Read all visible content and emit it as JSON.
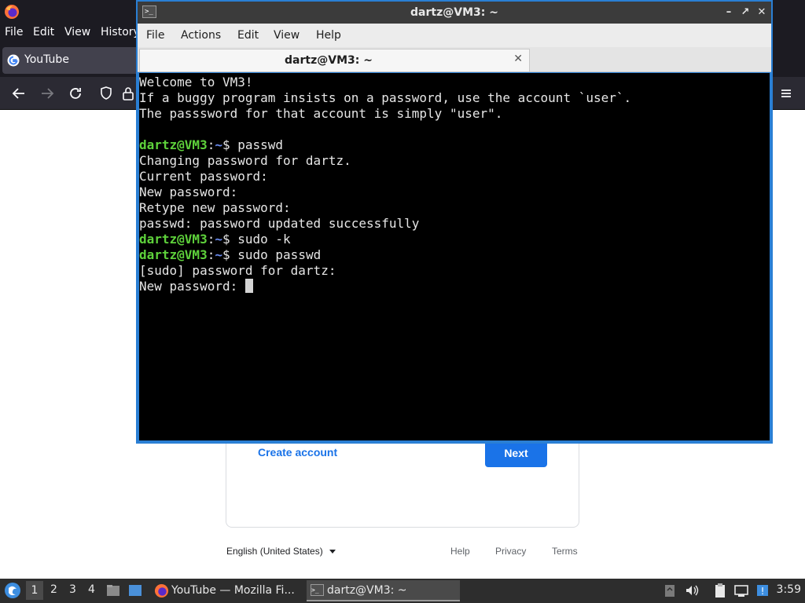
{
  "firefox": {
    "menu": [
      "File",
      "Edit",
      "View",
      "History"
    ],
    "tab_title": "YouTube"
  },
  "google_signin": {
    "create_account": "Create account",
    "next": "Next",
    "language": "English (United States)",
    "footer_links": [
      "Help",
      "Privacy",
      "Terms"
    ]
  },
  "terminal": {
    "window_title": "dartz@VM3: ~",
    "menu": [
      "File",
      "Actions",
      "Edit",
      "View",
      "Help"
    ],
    "tab_title": "dartz@VM3: ~",
    "prompt_user": "dartz@VM3",
    "prompt_path": "~",
    "lines": [
      {
        "type": "text",
        "text": "Welcome to VM3!"
      },
      {
        "type": "text",
        "text": "If a buggy program insists on a password, use the account `user`."
      },
      {
        "type": "text",
        "text": "The passsword for that account is simply \"user\"."
      },
      {
        "type": "text",
        "text": ""
      },
      {
        "type": "prompt",
        "text": "passwd"
      },
      {
        "type": "text",
        "text": "Changing password for dartz."
      },
      {
        "type": "text",
        "text": "Current password:"
      },
      {
        "type": "text",
        "text": "New password:"
      },
      {
        "type": "text",
        "text": "Retype new password:"
      },
      {
        "type": "text",
        "text": "passwd: password updated successfully"
      },
      {
        "type": "prompt",
        "text": "sudo -k"
      },
      {
        "type": "prompt",
        "text": "sudo passwd"
      },
      {
        "type": "text",
        "text": "[sudo] password for dartz:"
      },
      {
        "type": "cursor",
        "text": "New password: "
      }
    ]
  },
  "taskbar": {
    "workspaces": [
      "1",
      "2",
      "3",
      "4"
    ],
    "tasks": [
      "YouTube — Mozilla Fi...",
      "dartz@VM3: ~"
    ],
    "clock": "3:59"
  },
  "colors": {
    "terminal_bg": "#000000",
    "prompt_user": "#5ed13b",
    "prompt_path": "#6a8cf0",
    "google_blue": "#1a73e8",
    "window_border_active": "#2a7fd4"
  }
}
